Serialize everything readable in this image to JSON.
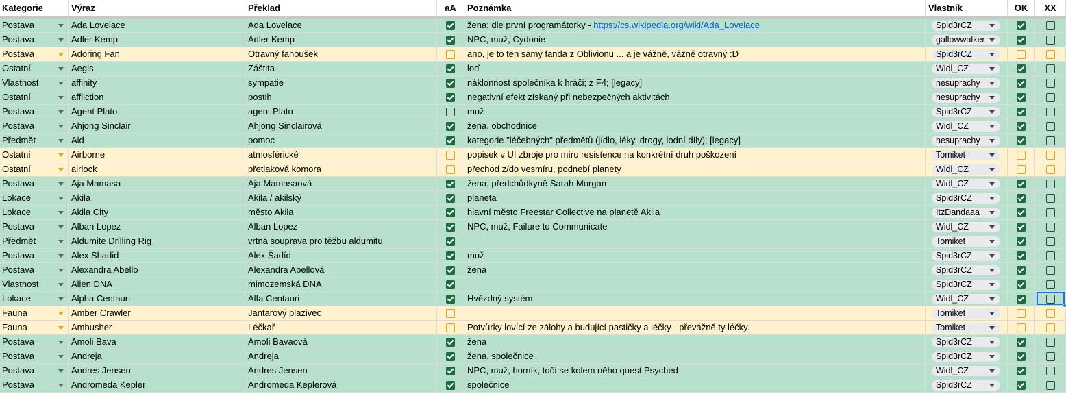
{
  "header": {
    "kategorie": "Kategorie",
    "vyraz": "Výraz",
    "preklad": "Překlad",
    "aa": "aA",
    "poznamka": "Poznámka",
    "vlastnik": "Vlastník",
    "ok": "OK",
    "xx": "XX"
  },
  "colors": {
    "green_row": "#b7e1cd",
    "yellow_row": "#fff2cc",
    "checkbox": "#1e6b41",
    "orange": "#e8a317",
    "link": "#1155cc"
  },
  "rows": [
    {
      "kat": "Postava",
      "vyr": "Ada Lovelace",
      "pre": "Ada Lovelace",
      "aa": true,
      "poz": "žena; dle první programátorky - ",
      "link": "https://cs.wikipedia.org/wiki/Ada_Lovelace",
      "vl": "Spid3rCZ",
      "ok": true,
      "xx": false,
      "status": "green"
    },
    {
      "kat": "Postava",
      "vyr": "Adler Kemp",
      "pre": "Adler Kemp",
      "aa": true,
      "poz": "NPC, muž, Cydonie",
      "vl": "gallowwalker",
      "ok": true,
      "xx": false,
      "status": "green"
    },
    {
      "kat": "Postava",
      "vyr": "Adoring Fan",
      "pre": "Otravný fanoušek",
      "aa": false,
      "poz": "ano, je to ten samý fanda z Oblivionu ... a je vážně, vážně otravný :D",
      "vl": "Spid3rCZ",
      "ok": false,
      "xx": false,
      "status": "yellow",
      "note": true
    },
    {
      "kat": "Ostatní",
      "vyr": "Aegis",
      "pre": "Záštita",
      "aa": true,
      "poz": "loď",
      "vl": "Widl_CZ",
      "ok": true,
      "xx": false,
      "status": "green"
    },
    {
      "kat": "Vlastnost",
      "vyr": "affinity",
      "pre": "sympatie",
      "aa": true,
      "poz": "náklonnost společníka k hráči; z F4; [legacy]",
      "vl": "nesuprachy",
      "ok": true,
      "xx": false,
      "status": "green"
    },
    {
      "kat": "Ostatní",
      "vyr": "affliction",
      "pre": "postih",
      "aa": true,
      "poz": "negativní efekt získaný při nebezpečných aktivitách",
      "vl": "nesuprachy",
      "ok": true,
      "xx": false,
      "status": "green"
    },
    {
      "kat": "Postava",
      "vyr": "Agent Plato",
      "pre": "agent Plato",
      "aa": false,
      "poz": "muž",
      "vl": "Spid3rCZ",
      "ok": true,
      "xx": false,
      "status": "green"
    },
    {
      "kat": "Postava",
      "vyr": "Ahjong Sinclair",
      "pre": "Ahjong Sinclairová",
      "aa": true,
      "poz": "žena, obchodnice",
      "vl": "Widl_CZ",
      "ok": true,
      "xx": false,
      "status": "green"
    },
    {
      "kat": "Předmět",
      "vyr": "Aid",
      "pre": "pomoc",
      "aa": true,
      "poz": "kategorie \"léčebných\" předmětů (jídlo, léky, drogy, lodní díly); [legacy]",
      "vl": "nesuprachy",
      "ok": true,
      "xx": false,
      "status": "green"
    },
    {
      "kat": "Ostatní",
      "vyr": "Airborne",
      "pre": "atmosférické",
      "aa": false,
      "poz": "popisek v UI zbroje pro míru resistence na konkrétní druh poškození",
      "vl": "Tomiket",
      "ok": false,
      "xx": false,
      "status": "yellow",
      "note": true
    },
    {
      "kat": "Ostatní",
      "vyr": "airlock",
      "pre": "přetlaková komora",
      "aa": false,
      "poz": "přechod z/do vesmíru, podnebí planety",
      "vl": "Widl_CZ",
      "ok": false,
      "xx": false,
      "status": "yellow"
    },
    {
      "kat": "Postava",
      "vyr": "Aja Mamasa",
      "pre": "Aja Mamasaová",
      "aa": true,
      "poz": "žena, předchůdkyně Sarah Morgan",
      "vl": "Widl_CZ",
      "ok": true,
      "xx": false,
      "status": "green"
    },
    {
      "kat": "Lokace",
      "vyr": "Akila",
      "pre": "Akila / akilský",
      "aa": true,
      "poz": "planeta",
      "vl": "Spid3rCZ",
      "ok": true,
      "xx": false,
      "status": "green"
    },
    {
      "kat": "Lokace",
      "vyr": "Akila City",
      "pre": "město Akila",
      "aa": true,
      "poz": "hlavní město Freestar Collective na planetě Akila",
      "vl": "ItzDandaaa",
      "ok": true,
      "xx": false,
      "status": "green"
    },
    {
      "kat": "Postava",
      "vyr": "Alban Lopez",
      "pre": "Alban Lopez",
      "aa": true,
      "poz": "NPC, muž, Failure to Communicate",
      "vl": "Widl_CZ",
      "ok": true,
      "xx": false,
      "status": "green"
    },
    {
      "kat": "Předmět",
      "vyr": "Aldumite Drilling Rig",
      "pre": "vrtná souprava pro těžbu aldumitu",
      "aa": true,
      "poz": "",
      "vl": "Tomiket",
      "ok": true,
      "xx": false,
      "status": "green"
    },
    {
      "kat": "Postava",
      "vyr": "Alex Shadid",
      "pre": "Alex Šadíd",
      "aa": true,
      "poz": "muž",
      "vl": "Spid3rCZ",
      "ok": true,
      "xx": false,
      "status": "green"
    },
    {
      "kat": "Postava",
      "vyr": "Alexandra Abello",
      "pre": "Alexandra Abellová",
      "aa": true,
      "poz": "žena",
      "vl": "Spid3rCZ",
      "ok": true,
      "xx": false,
      "status": "green"
    },
    {
      "kat": "Vlastnost",
      "vyr": "Alien DNA",
      "pre": "mimozemská DNA",
      "aa": true,
      "poz": "",
      "vl": "Spid3rCZ",
      "ok": true,
      "xx": false,
      "status": "green"
    },
    {
      "kat": "Lokace",
      "vyr": "Alpha Centauri",
      "pre": "Alfa Centauri",
      "aa": true,
      "poz": "Hvězdný systém",
      "vl": "Widl_CZ",
      "ok": true,
      "xx": false,
      "status": "green"
    },
    {
      "kat": "Fauna",
      "vyr": "Amber Crawler",
      "pre": "Jantarový plazivec",
      "aa": false,
      "poz": "",
      "vl": "Tomiket",
      "ok": false,
      "xx": false,
      "status": "yellow"
    },
    {
      "kat": "Fauna",
      "vyr": "Ambusher",
      "pre": "Léčkař",
      "aa": false,
      "poz": "Potvůrky lovící ze zálohy a budující pastičky a léčky - převážně ty léčky.",
      "vl": "Tomiket",
      "ok": false,
      "xx": false,
      "status": "yellow"
    },
    {
      "kat": "Postava",
      "vyr": "Amoli Bava",
      "pre": "Amoli Bavaová",
      "aa": true,
      "poz": "žena",
      "vl": "Spid3rCZ",
      "ok": true,
      "xx": false,
      "status": "green"
    },
    {
      "kat": "Postava",
      "vyr": "Andreja",
      "pre": "Andreja",
      "aa": true,
      "poz": "žena, společnice",
      "vl": "Spid3rCZ",
      "ok": true,
      "xx": false,
      "status": "green"
    },
    {
      "kat": "Postava",
      "vyr": "Andres Jensen",
      "pre": "Andres Jensen",
      "aa": true,
      "poz": "NPC, muž, horník, točí se kolem něho quest Psyched",
      "vl": "Widl_CZ",
      "ok": true,
      "xx": false,
      "status": "green"
    },
    {
      "kat": "Postava",
      "vyr": "Andromeda Kepler",
      "pre": "Andromeda Keplerová",
      "aa": true,
      "poz": "společnice",
      "vl": "Spid3rCZ",
      "ok": true,
      "xx": false,
      "status": "green"
    }
  ]
}
